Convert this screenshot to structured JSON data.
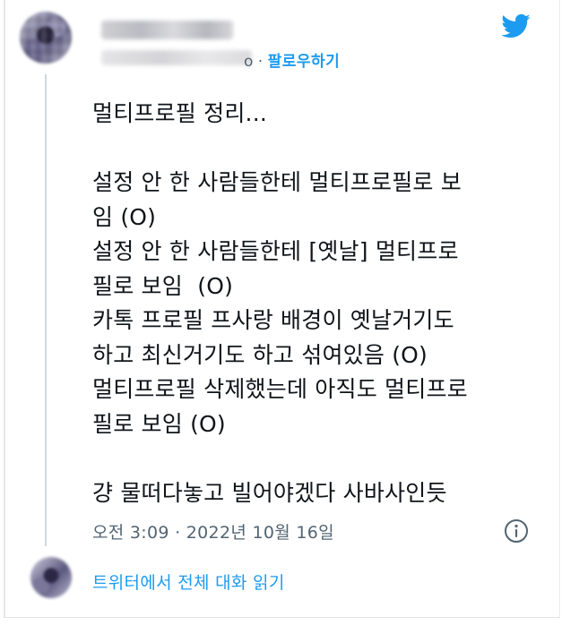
{
  "header": {
    "follow_separator": "o · ",
    "follow_label": "팔로우하기"
  },
  "tweet": {
    "text": "멀티프로필 정리...\n\n설정 안 한 사람들한테 멀티프로필로 보\n임 (O)\n설정 안 한 사람들한테 [옛날] 멀티프로\n필로 보임  (O)\n카톡 프로필 프사랑 배경이 옛날거기도\n하고 최신거기도 하고 섞여있음 (O)\n멀티프로필 삭제했는데 아직도 멀티프로\n필로 보임 (O)\n\n걍 물떠다놓고 빌어야겠다 사바사인듯",
    "timestamp": "오전 3:09 · 2022년 10월 16일"
  },
  "footer": {
    "read_conversation": "트위터에서 전체 대화 읽기"
  },
  "colors": {
    "accent": "#1d9bf0",
    "text": "#0f1419",
    "muted": "#536471"
  },
  "icons": {
    "logo": "twitter-bird-icon",
    "info": "info-icon"
  }
}
